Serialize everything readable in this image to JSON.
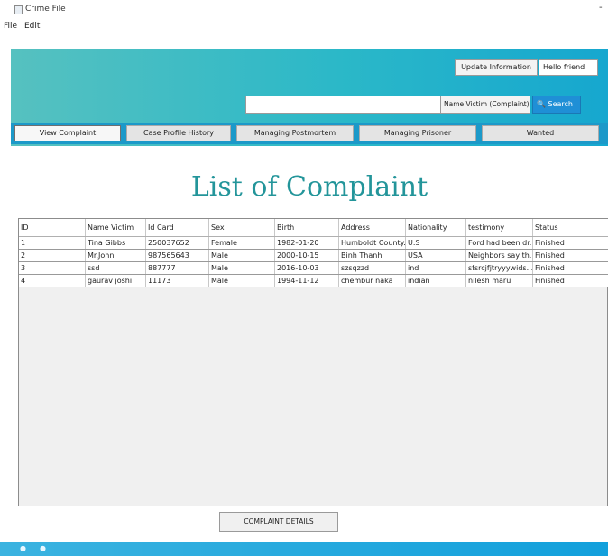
{
  "window": {
    "title": "Crime File"
  },
  "menu": {
    "items": [
      "File",
      "Edit"
    ]
  },
  "header": {
    "update_label": "Update Information",
    "hello_text": "Hello friend",
    "search_input_value": "",
    "search_select_value": "Name Victim (Complaint)",
    "search_label": "Search"
  },
  "tabs": [
    {
      "label": "View Complaint"
    },
    {
      "label": "Case Profile History"
    },
    {
      "label": "Managing Postmortem"
    },
    {
      "label": "Managing Prisoner"
    },
    {
      "label": "Wanted"
    }
  ],
  "main": {
    "title": "List of Complaint",
    "details_button": "COMPLAINT DETAILS"
  },
  "table": {
    "headers": [
      "ID",
      "Name Victim",
      "Id Card",
      "Sex",
      "Birth",
      "Address",
      "Nationality",
      "testimony",
      "Status"
    ],
    "rows": [
      [
        "1",
        "Tina Gibbs",
        "250037652",
        "Female",
        "1982-01-20",
        "Humboldt County...",
        "U.S",
        "Ford had been dr...",
        "Finished"
      ],
      [
        "2",
        "Mr.John",
        "987565643",
        "Male",
        "2000-10-15",
        "Binh Thanh",
        "USA",
        "Neighbors say th...",
        "Finished"
      ],
      [
        "3",
        "ssd",
        "887777",
        "Male",
        "2016-10-03",
        "szsqzzd",
        "ind",
        "sfsrcjfjtryyywids...",
        "Finished"
      ],
      [
        "4",
        "gaurav joshi",
        "11173",
        "Male",
        "1994-11-12",
        "chembur naka",
        "indian",
        "nilesh maru",
        "Finished"
      ]
    ]
  },
  "colors": {
    "header_start": "#56c1c0",
    "header_end": "#16a7cf",
    "tabbar": "#1c99c9",
    "title": "#23959a",
    "search_button": "#1f8fd6"
  }
}
